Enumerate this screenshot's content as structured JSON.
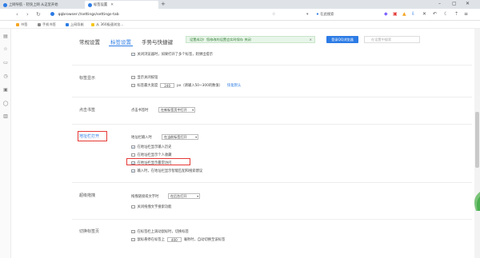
{
  "browser": {
    "tabs": [
      {
        "label": "上网导航 - 轻快上网 从这里开始",
        "active": false
      },
      {
        "label": "标签设置",
        "active": true
      }
    ],
    "address": "qqbrowser://settings/settings-tab",
    "search_placeholder": "在此搜索",
    "bookmarks": [
      {
        "label": "书签"
      },
      {
        "label": "手机书签"
      },
      {
        "label": "上网导航"
      },
      {
        "label": "从 360极速浏览..."
      }
    ]
  },
  "settings": {
    "tabs": [
      {
        "label": "常规设置"
      },
      {
        "label": "标签设置"
      },
      {
        "label": "手势与快捷键"
      }
    ],
    "notice": "设置成功！您修改的设置会实时保存  关闭",
    "login_button": "登录QQ浏览器",
    "search_placeholder": "在设置中搜索",
    "top_row": "关闭浏览器时，如果打开了多个标签，则弹出提示",
    "tab_display": {
      "label": "标签显示",
      "show_close": "显示关闭按钮",
      "max_width_pre": "标签最大宽度",
      "max_width_value": "240",
      "max_width_post": "px（请输入50~300的数值）",
      "restore_link": "恢复默认"
    },
    "bookmark_click": {
      "label": "点击书签",
      "row_label": "点击书签时",
      "select": "在新标签页中打开"
    },
    "address_open": {
      "label": "地址栏打开",
      "row_label": "地址栏输入时",
      "select": "在当前标签打开",
      "options": [
        {
          "label": "在地址栏显示输入历史",
          "checked": true
        },
        {
          "label": "在地址栏显示个人收藏",
          "checked": false
        },
        {
          "label": "在地址栏显示最常访问",
          "checked": true
        },
        {
          "label": "输入时，在地址栏显示智能匹配和搜索建议",
          "checked": true
        }
      ]
    },
    "drag": {
      "label": "超级拖拽",
      "row_label": "拖拽链接或文字时",
      "select": "在后台打开",
      "disable": "关闭拖拽文字搜索功能"
    },
    "switch": {
      "label": "切换标签页",
      "close_switch": "在标签栏上滚动鼠标时，切换标签",
      "hover_pre": "鼠标悬停在标签上",
      "hover_value": "400",
      "hover_post": "毫秒时，自动切换至该标签"
    }
  },
  "colors": {
    "accent": "#2c7be5",
    "highlight": "#e53935"
  }
}
